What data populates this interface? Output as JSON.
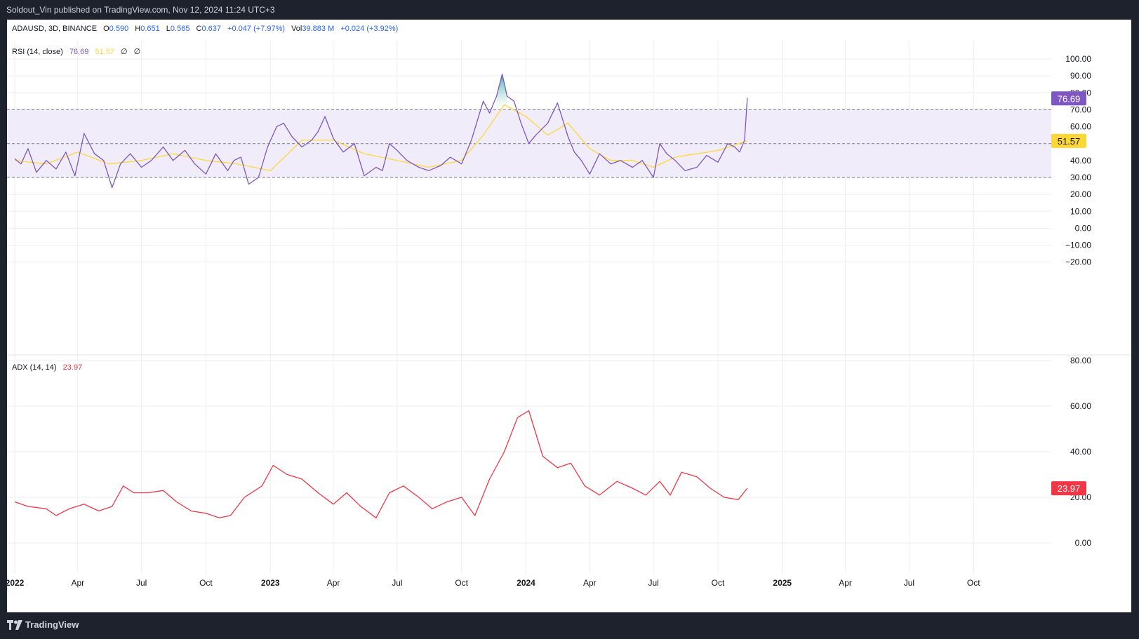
{
  "header": {
    "published": "Soldout_Vin published on TradingView.com, Nov 12, 2024 11:24 UTC+3"
  },
  "footer": {
    "brand": "TradingView"
  },
  "symbol_line": {
    "symbol": "ADAUSD, 3D, BINANCE",
    "o_label": "O",
    "o": "0.590",
    "h_label": "H",
    "h": "0.651",
    "l_label": "L",
    "l": "0.565",
    "c_label": "C",
    "c": "0.637",
    "change": "+0.047 (+7.97%)",
    "vol_label": "Vol",
    "vol": "39.883 M",
    "vol_change": "+0.024 (+3.92%)"
  },
  "rsi_legend": {
    "name": "RSI (14, close)",
    "rsi": "76.69",
    "ma": "51.57",
    "extra1": "∅",
    "extra2": "∅"
  },
  "adx_legend": {
    "name": "ADX (14, 14)",
    "value": "23.97"
  },
  "colors": {
    "rsi": "#7e57c2",
    "rsi_ma": "#fdd835",
    "adx": "#f23645",
    "band_fill": "#f1ecfa",
    "values_blue": "#2962ff",
    "grid": "#eceef2"
  },
  "chart_data": [
    {
      "type": "line",
      "title": "RSI (14, close)",
      "x_axis_labels": [
        "2022",
        "Apr",
        "Jul",
        "Oct",
        "2023",
        "Apr",
        "Jul",
        "Oct",
        "2024",
        "Apr",
        "Jul",
        "Oct",
        "2025",
        "Apr",
        "Jul",
        "Oct"
      ],
      "y_ticks": [
        "100.00",
        "90.00",
        "80.00",
        "70.00",
        "60.00",
        "40.00",
        "30.00",
        "20.00",
        "10.00",
        "0.00",
        "−10.00",
        "−20.00"
      ],
      "ylim": [
        -20,
        100
      ],
      "bands": {
        "upper": 70,
        "middle": 50,
        "lower": 30
      },
      "last_value_labels": {
        "rsi": "76.69",
        "ma": "51.57"
      },
      "series": [
        {
          "name": "RSI",
          "x": [
            "2022-01-01",
            "2022-01-10",
            "2022-01-20",
            "2022-02-01",
            "2022-02-15",
            "2022-03-01",
            "2022-03-15",
            "2022-03-28",
            "2022-04-10",
            "2022-04-25",
            "2022-05-08",
            "2022-05-20",
            "2022-06-01",
            "2022-06-15",
            "2022-07-01",
            "2022-07-15",
            "2022-08-01",
            "2022-08-15",
            "2022-09-01",
            "2022-09-15",
            "2022-10-01",
            "2022-10-15",
            "2022-11-01",
            "2022-11-10",
            "2022-11-20",
            "2022-12-01",
            "2022-12-15",
            "2022-12-28",
            "2023-01-10",
            "2023-01-20",
            "2023-02-01",
            "2023-02-15",
            "2023-03-01",
            "2023-03-10",
            "2023-03-20",
            "2023-04-01",
            "2023-04-15",
            "2023-05-01",
            "2023-05-15",
            "2023-06-01",
            "2023-06-10",
            "2023-06-20",
            "2023-07-01",
            "2023-07-15",
            "2023-08-01",
            "2023-08-15",
            "2023-09-01",
            "2023-09-15",
            "2023-10-01",
            "2023-10-15",
            "2023-11-01",
            "2023-11-10",
            "2023-11-20",
            "2023-11-28",
            "2023-12-05",
            "2023-12-15",
            "2023-12-25",
            "2024-01-05",
            "2024-01-15",
            "2024-02-01",
            "2024-02-15",
            "2024-03-01",
            "2024-03-10",
            "2024-03-20",
            "2024-04-01",
            "2024-04-15",
            "2024-05-01",
            "2024-05-15",
            "2024-06-01",
            "2024-06-15",
            "2024-07-01",
            "2024-07-10",
            "2024-07-20",
            "2024-08-01",
            "2024-08-15",
            "2024-09-01",
            "2024-09-15",
            "2024-10-01",
            "2024-10-15",
            "2024-10-25",
            "2024-11-01",
            "2024-11-08",
            "2024-11-12"
          ],
          "values": [
            41,
            38,
            47,
            33,
            40,
            35,
            45,
            31,
            56,
            44,
            40,
            24,
            38,
            44,
            36,
            40,
            48,
            40,
            46,
            38,
            32,
            44,
            34,
            40,
            42,
            26,
            30,
            48,
            60,
            62,
            54,
            48,
            52,
            57,
            66,
            53,
            45,
            50,
            31,
            36,
            34,
            50,
            46,
            40,
            36,
            34,
            37,
            42,
            38,
            52,
            75,
            68,
            78,
            91,
            78,
            75,
            62,
            50,
            55,
            62,
            74,
            54,
            45,
            40,
            32,
            44,
            38,
            40,
            36,
            40,
            30,
            50,
            44,
            40,
            34,
            36,
            43,
            39,
            50,
            48,
            45,
            52,
            77
          ]
        },
        {
          "name": "RSI MA",
          "x": [
            "2022-01-01",
            "2022-02-15",
            "2022-04-01",
            "2022-05-15",
            "2022-07-01",
            "2022-08-15",
            "2022-10-01",
            "2022-11-15",
            "2023-01-01",
            "2023-02-15",
            "2023-04-01",
            "2023-05-15",
            "2023-07-01",
            "2023-08-15",
            "2023-10-01",
            "2023-11-01",
            "2023-12-01",
            "2024-01-01",
            "2024-02-01",
            "2024-03-01",
            "2024-04-01",
            "2024-05-01",
            "2024-06-01",
            "2024-07-01",
            "2024-08-01",
            "2024-09-01",
            "2024-10-01",
            "2024-11-12"
          ],
          "values": [
            40,
            38,
            45,
            38,
            40,
            44,
            40,
            38,
            34,
            52,
            52,
            44,
            40,
            36,
            40,
            55,
            73,
            66,
            55,
            62,
            47,
            40,
            40,
            36,
            42,
            44,
            46,
            51.57
          ]
        }
      ]
    },
    {
      "type": "line",
      "title": "ADX (14, 14)",
      "y_ticks": [
        "80.00",
        "60.00",
        "40.00",
        "20.00",
        "0.00"
      ],
      "ylim": [
        0,
        80
      ],
      "last_value_label": "23.97",
      "series": [
        {
          "name": "ADX",
          "x": [
            "2022-01-01",
            "2022-01-20",
            "2022-02-15",
            "2022-03-01",
            "2022-03-20",
            "2022-04-10",
            "2022-05-01",
            "2022-05-20",
            "2022-06-05",
            "2022-06-20",
            "2022-07-10",
            "2022-08-01",
            "2022-08-20",
            "2022-09-10",
            "2022-10-01",
            "2022-10-20",
            "2022-11-05",
            "2022-11-25",
            "2022-12-20",
            "2023-01-05",
            "2023-01-25",
            "2023-02-15",
            "2023-03-10",
            "2023-04-01",
            "2023-04-20",
            "2023-05-10",
            "2023-06-01",
            "2023-06-20",
            "2023-07-10",
            "2023-08-01",
            "2023-08-20",
            "2023-09-10",
            "2023-10-01",
            "2023-10-20",
            "2023-11-10",
            "2023-12-01",
            "2023-12-20",
            "2024-01-05",
            "2024-01-25",
            "2024-02-15",
            "2024-03-05",
            "2024-03-25",
            "2024-04-15",
            "2024-05-10",
            "2024-06-01",
            "2024-06-20",
            "2024-07-10",
            "2024-07-25",
            "2024-08-10",
            "2024-09-01",
            "2024-09-20",
            "2024-10-10",
            "2024-10-30",
            "2024-11-12"
          ],
          "values": [
            18,
            16,
            15,
            12,
            15,
            17,
            14,
            16,
            25,
            22,
            22,
            23,
            18,
            14,
            13,
            11,
            12,
            20,
            25,
            34,
            30,
            28,
            22,
            17,
            22,
            16,
            11,
            22,
            25,
            20,
            15,
            18,
            20,
            12,
            28,
            40,
            55,
            58,
            38,
            33,
            35,
            25,
            21,
            27,
            24,
            21,
            27,
            21,
            31,
            29,
            24,
            20,
            19,
            23.97
          ]
        }
      ]
    }
  ]
}
